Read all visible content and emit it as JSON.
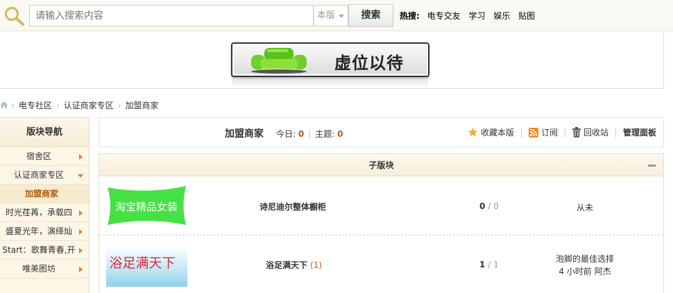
{
  "search": {
    "placeholder": "请输入搜索内容",
    "scope": "本版",
    "button_label": "搜索"
  },
  "hot_search": {
    "label": "热搜:",
    "terms": [
      "电专交友",
      "学习",
      "娱乐",
      "贴图"
    ]
  },
  "banner": {
    "text": "虚位以待"
  },
  "breadcrumb": [
    "电专社区",
    "认证商家专区",
    "加盟商家"
  ],
  "sidebar": {
    "title": "版块导航",
    "items": [
      {
        "label": "宿舍区",
        "indicator": "arrow-right"
      },
      {
        "label": "认证商家专区",
        "indicator": "arrow-down"
      },
      {
        "label": "加盟商家",
        "active": true
      },
      {
        "label": "时光荏苒，承载四",
        "indicator": "arrow-right"
      },
      {
        "label": "盛夏光年，演绎灿",
        "indicator": "arrow-right"
      },
      {
        "label": "Start：歌舞青春,开",
        "indicator": "arrow-right"
      },
      {
        "label": "唯美图坊",
        "indicator": "arrow-right"
      }
    ]
  },
  "forum": {
    "title": "加盟商家",
    "today_label": "今日:",
    "today_value": "0",
    "topics_label": "主题:",
    "topics_value": "0",
    "actions": {
      "favorite": "收藏本版",
      "subscribe": "订阅",
      "recycle": "回收站",
      "admin": "管理面板"
    }
  },
  "subforums": {
    "title": "子版块",
    "rows": [
      {
        "thumb_text": "淘宝精品女装",
        "name": "诗尼迪尔整体橱柜",
        "today": "",
        "threads": "0",
        "posts": "0",
        "last_post": "从未",
        "last_meta": ""
      },
      {
        "thumb_text": "浴足满天下",
        "name": "浴足满天下",
        "today": "(1)",
        "threads": "1",
        "posts": "1",
        "last_post": "泡脚的最佳选择",
        "last_meta": "4 小时前 阿杰"
      }
    ]
  },
  "colors": {
    "accent": "#c0571e",
    "nav_bg": "#fcf6e7",
    "thumb1_bg": "#44e244",
    "thumb2_bg": "#9cd6ee"
  }
}
